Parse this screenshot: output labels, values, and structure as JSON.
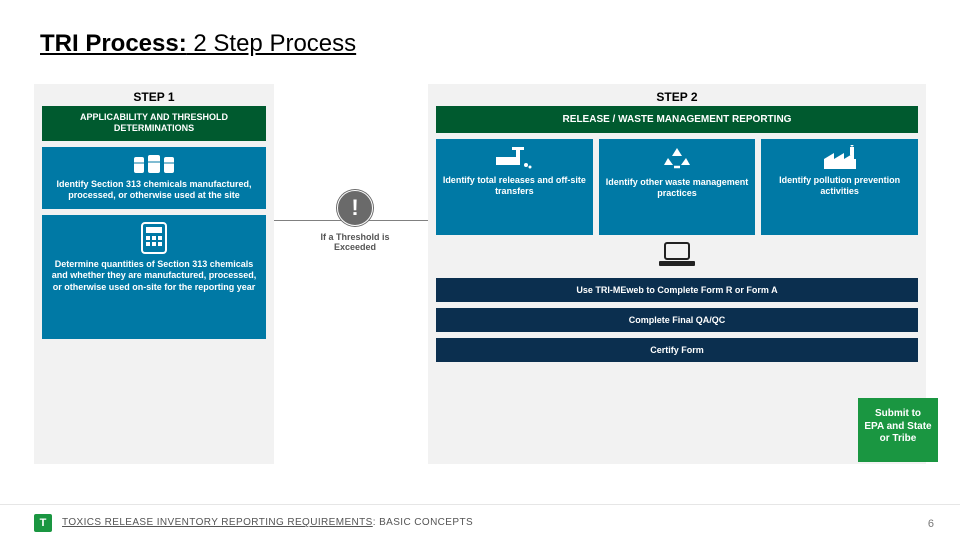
{
  "title": {
    "bold": "TRI Process:",
    "rest": " 2 Step Process"
  },
  "step1": {
    "label": "STEP 1",
    "header": "APPLICABILITY AND THRESHOLD DETERMINATIONS",
    "box1": "Identify Section 313 chemicals manufactured, processed, or otherwise used at the site",
    "box2": "Determine quantities of Section 313 chemicals and whether they are manufactured, processed, or otherwise used on-site for the reporting year"
  },
  "threshold": {
    "mark": "!",
    "text": "If a Threshold is Exceeded"
  },
  "step2": {
    "label": "STEP 2",
    "header": "RELEASE / WASTE MANAGEMENT REPORTING",
    "boxA": "Identify total releases and off-site transfers",
    "boxB": "Identify other waste management practices",
    "boxC": "Identify pollution prevention activities",
    "navy1": "Use TRI-MEweb to Complete Form R or Form A",
    "navy2": "Complete Final QA/QC",
    "navy3": "Certify Form"
  },
  "submit": "Submit to EPA and State or Tribe",
  "footer": {
    "underlined": "TOXICS RELEASE INVENTORY REPORTING REQUIREMENTS",
    "tail": ": BASIC CONCEPTS",
    "page": "6",
    "logo": "T"
  }
}
